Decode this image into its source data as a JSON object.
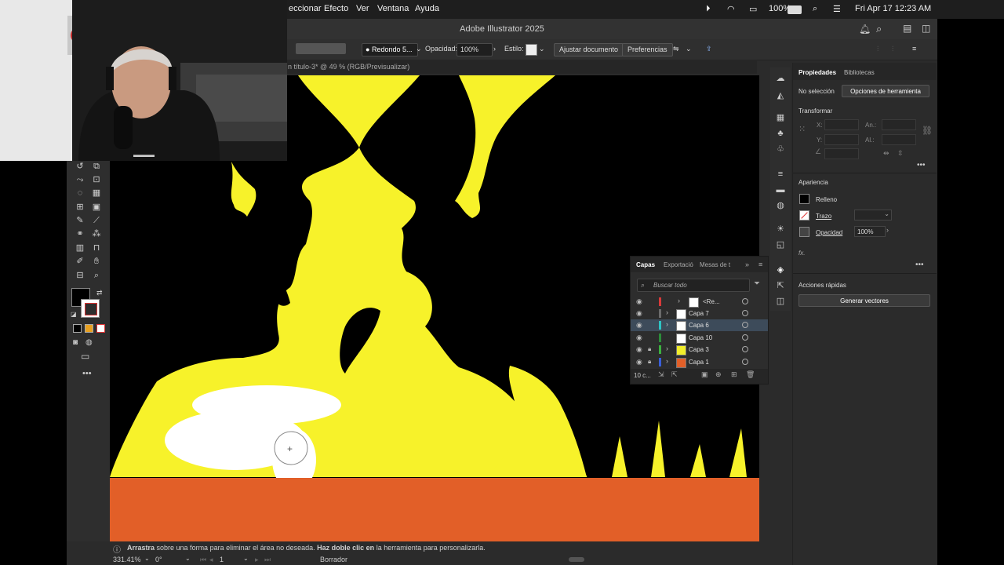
{
  "menubar": {
    "items": [
      "eccionar",
      "Efecto",
      "Ver",
      "Ventana",
      "Ayuda"
    ],
    "battery": "100%",
    "datetime": "Fri Apr 17  12:23 AM"
  },
  "window": {
    "title": "Adobe Illustrator 2025"
  },
  "control": {
    "brush": "Redondo 5...",
    "opacity_label": "Opacidad:",
    "opacity_value": "100%",
    "style_label": "Estilo:",
    "fit_button": "Ajustar documento",
    "prefs_button": "Preferencias"
  },
  "document": {
    "tab": "n título-3* @ 49 % (RGB/Previsualizar)"
  },
  "status": {
    "hint_bold1": "Arrastra",
    "hint_text1": " sobre una forma para eliminar el área no deseada. ",
    "hint_bold2": "Haz doble clic en",
    "hint_text2": " la herramienta para personalizarla.",
    "zoom": "331.41%",
    "rotate": "0°",
    "artboard": "1",
    "tool_name": "Borrador"
  },
  "properties": {
    "tab_props": "Propiedades",
    "tab_libs": "Bibliotecas",
    "no_selection": "No selección",
    "tool_options": "Opciones de herramienta",
    "transform": "Transformar",
    "x": "X:",
    "y": "Y:",
    "w": "An.:",
    "h": "Al.:",
    "appearance": "Apariencia",
    "fill": "Relleno",
    "stroke": "Trazo",
    "opacity": "Opacidad",
    "opacity_value": "100%",
    "fx": "fx.",
    "quick_actions": "Acciones rápidas",
    "generate_vectors": "Generar vectores"
  },
  "layers": {
    "tabs": [
      "Capas",
      "Exportació",
      "Mesas de t"
    ],
    "search_placeholder": "Buscar todo",
    "rows": [
      {
        "name": "<Re...",
        "color": "#d83a3a",
        "thumb": "#ffffff",
        "lock": false,
        "indent": true
      },
      {
        "name": "Capa 7",
        "color": "#6b6b6b",
        "thumb": "#ffffff",
        "lock": false,
        "indent": false
      },
      {
        "name": "Capa 6",
        "color": "#2ec4c4",
        "thumb": "#ffffff",
        "lock": false,
        "indent": false,
        "selected": true
      },
      {
        "name": "Capa 10",
        "color": "#2c8c3a",
        "thumb": "#ffffff",
        "lock": false,
        "indent": false
      },
      {
        "name": "Capa 3",
        "color": "#3cb040",
        "thumb": "#f2ee2a",
        "lock": true,
        "indent": false
      },
      {
        "name": "Capa 1",
        "color": "#3a5fd8",
        "thumb": "#e25f28",
        "lock": true,
        "indent": false
      }
    ],
    "count": "10 c..."
  },
  "colors": {
    "ground": "#e25f28",
    "flame": "#f7f22a",
    "panel": "#2b2b2b"
  }
}
